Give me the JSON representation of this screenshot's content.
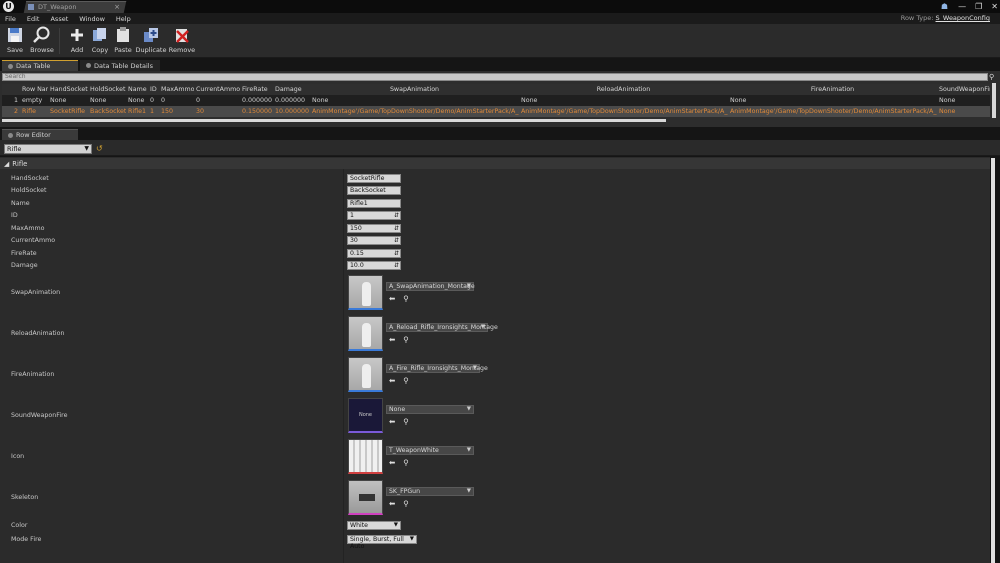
{
  "window": {
    "tab_title": "DT_Weapon",
    "controls": [
      "—",
      "❐",
      "✕"
    ],
    "row_type_label": "Row Type:",
    "row_type_value": "S_WeaponConfig"
  },
  "menu": [
    "File",
    "Edit",
    "Asset",
    "Window",
    "Help"
  ],
  "toolbar": {
    "save": "Save",
    "browse": "Browse",
    "add": "Add",
    "copy": "Copy",
    "paste": "Paste",
    "duplicate": "Duplicate",
    "remove": "Remove"
  },
  "tabs": {
    "data_table": "Data Table",
    "data_table_details": "Data Table Details",
    "row_editor": "Row Editor"
  },
  "data_table": {
    "search_placeholder": "Search",
    "columns": [
      "",
      "Row Nam",
      "HandSocket",
      "HoldSocket",
      "Name",
      "ID",
      "MaxAmmo",
      "CurrentAmmo",
      "FireRate",
      "Damage",
      "SwapAnimation",
      "ReloadAnimation",
      "FireAnimation",
      "SoundWeaponFire"
    ],
    "rows": [
      [
        "1",
        "empty",
        "None",
        "None",
        "None",
        "0",
        "0",
        "0",
        "0.000000",
        "0.000000",
        "None",
        "None",
        "None",
        "None"
      ],
      [
        "2",
        "Rifle",
        "SocketRifle",
        "BackSocket",
        "Rifle1",
        "1",
        "150",
        "30",
        "0.150000",
        "10.000000",
        "AnimMontage'/Game/TopDownShooter/Demo/AnimStarterPack/A_Swap",
        "AnimMontage'/Game/TopDownShooter/Demo/AnimStarterPack/A_Relo",
        "AnimMontage'/Game/TopDownShooter/Demo/AnimStarterPack/A_Fire_F",
        "None"
      ]
    ]
  },
  "row_editor": {
    "selected_row": "Rifle",
    "category": "Rifle",
    "hand_socket": {
      "label": "HandSocket",
      "value": "SocketRifle"
    },
    "hold_socket": {
      "label": "HoldSocket",
      "value": "BackSocket"
    },
    "name": {
      "label": "Name",
      "value": "Rifle1"
    },
    "id": {
      "label": "ID",
      "value": "1"
    },
    "max_ammo": {
      "label": "MaxAmmo",
      "value": "150"
    },
    "current_ammo": {
      "label": "CurrentAmmo",
      "value": "30"
    },
    "fire_rate": {
      "label": "FireRate",
      "value": "0.15"
    },
    "damage": {
      "label": "Damage",
      "value": "10.0"
    },
    "swap_animation": {
      "label": "SwapAnimation",
      "value": "A_SwapAnimation_Montage"
    },
    "reload_animation": {
      "label": "ReloadAnimation",
      "value": "A_Reload_Rifle_Ironsights_Montage"
    },
    "fire_animation": {
      "label": "FireAnimation",
      "value": "A_Fire_Rifle_Ironsights_Montage"
    },
    "sound_weapon_fire": {
      "label": "SoundWeaponFire",
      "value": "None",
      "thumb_text": "None"
    },
    "icon": {
      "label": "Icon",
      "value": "T_WeaponWhite"
    },
    "skeleton": {
      "label": "Skeleton",
      "value": "SK_FPGun"
    },
    "color": {
      "label": "Color",
      "value": "White"
    },
    "mode_fire": {
      "label": "Mode Fire",
      "value": "Single, Burst, Full Auto"
    }
  },
  "colors": {
    "selected_row_text": "#e08a3a",
    "active_tab_accent": "#d0a030",
    "anim_thumb_border": "#3a7ad8",
    "sound_thumb_border": "#7a5ad8",
    "texture_thumb_border": "#d04040",
    "mesh_thumb_border": "#d040c0"
  }
}
